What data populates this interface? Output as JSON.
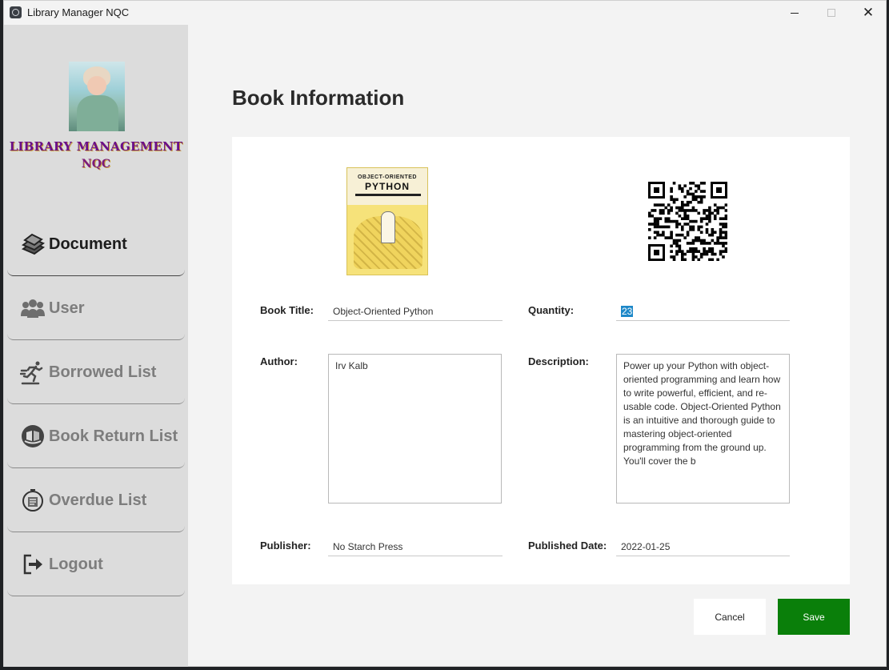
{
  "window": {
    "title": "Library Manager NQC",
    "minimize_icon": "minimize-icon",
    "maximize_icon": "maximize-icon",
    "close_icon": "close-icon",
    "close_glyph": "✕"
  },
  "sidebar": {
    "brand_line1": "LIBRARY MANAGEMENT",
    "brand_line2": "NQC",
    "items": [
      {
        "label": "Document",
        "icon": "books-icon",
        "active": true
      },
      {
        "label": "User",
        "icon": "users-icon",
        "active": false
      },
      {
        "label": "Borrowed List",
        "icon": "running-person-icon",
        "active": false
      },
      {
        "label": "Book Return List",
        "icon": "book-return-icon",
        "active": false
      },
      {
        "label": "Overdue List",
        "icon": "overdue-clock-icon",
        "active": false
      },
      {
        "label": "Logout",
        "icon": "logout-icon",
        "active": false
      }
    ]
  },
  "main": {
    "title": "Book Information",
    "cover": {
      "line1": "OBJECT-ORIENTED",
      "line2": "PYTHON"
    },
    "fields": {
      "book_title": {
        "label": "Book Title:",
        "value": "Object-Oriented Python"
      },
      "quantity": {
        "label": "Quantity:",
        "value": "23"
      },
      "author": {
        "label": "Author:",
        "value": "Irv Kalb"
      },
      "description": {
        "label": "Description:",
        "value": "Power up your Python with object-oriented programming and learn how to write powerful, efficient, and re-usable code. Object-Oriented Python is an intuitive and thorough guide to mastering object-oriented programming from the ground up. You'll cover the b"
      },
      "publisher": {
        "label": "Publisher:",
        "value": "No Starch Press"
      },
      "published_date": {
        "label": "Published Date:",
        "value": "2022-01-25"
      }
    },
    "buttons": {
      "cancel": "Cancel",
      "save": "Save"
    },
    "colors": {
      "save": "#0a7f0a",
      "selection": "#1e88c8",
      "brand": "#6a0f8a"
    }
  }
}
